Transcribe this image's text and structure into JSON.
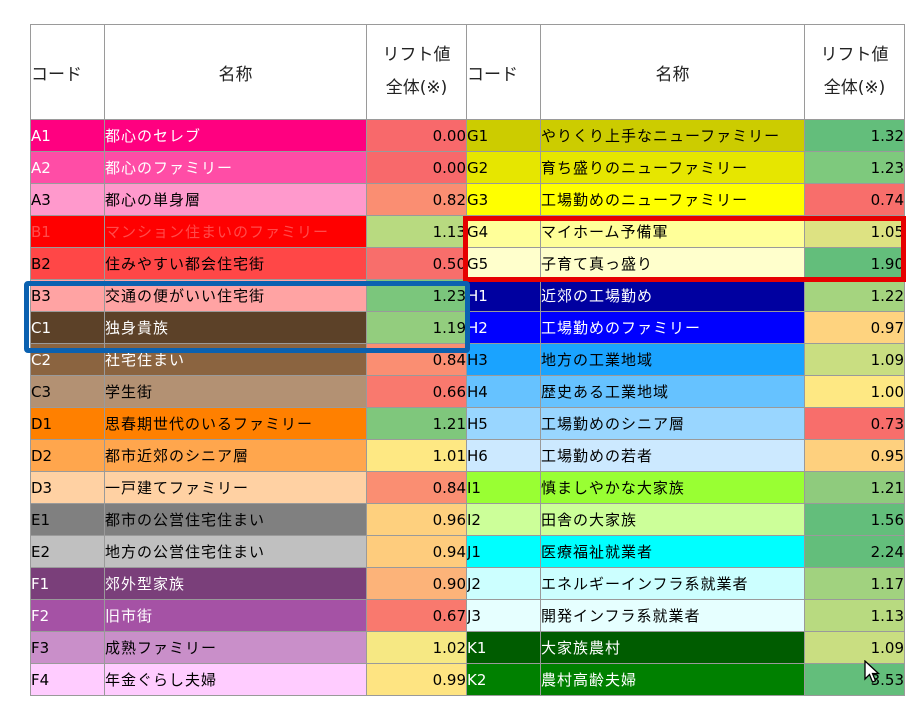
{
  "header": {
    "code": "コード",
    "name": "名称",
    "lift_line1": "リフト値",
    "lift_line2": "全体(※)"
  },
  "rows": [
    {
      "left": {
        "code": "A1",
        "name": "都心のセレブ",
        "value": "0.00",
        "bg": "#ff0080",
        "fg": "#ffffff",
        "vbg": "#f8696b"
      },
      "right": {
        "code": "G1",
        "name": "やりくり上手なニューファミリー",
        "value": "1.32",
        "bg": "#cccc00",
        "fg": "#000000",
        "vbg": "#63be7b"
      }
    },
    {
      "left": {
        "code": "A2",
        "name": "都心のファミリー",
        "value": "0.00",
        "bg": "#ff4da6",
        "fg": "#ffffff",
        "vbg": "#f8696b"
      },
      "right": {
        "code": "G2",
        "name": "育ち盛りのニューファミリー",
        "value": "1.23",
        "bg": "#e6e600",
        "fg": "#000000",
        "vbg": "#7ec97d"
      }
    },
    {
      "left": {
        "code": "A3",
        "name": "都心の単身層",
        "value": "0.82",
        "bg": "#ff99cc",
        "fg": "#000000",
        "vbg": "#fa8e72"
      },
      "right": {
        "code": "G3",
        "name": "工場勤めのニューファミリー",
        "value": "0.74",
        "bg": "#ffff00",
        "fg": "#000000",
        "vbg": "#f86e6b"
      }
    },
    {
      "left": {
        "code": "B1",
        "name": "マンション住まいのファミリー",
        "value": "1.13",
        "bg": "#ff0000",
        "fg": "#ff4b4b",
        "vbg": "#b8da80"
      },
      "right": {
        "code": "G4",
        "name": "マイホーム予備軍",
        "value": "1.05",
        "bg": "#ffff99",
        "fg": "#000000",
        "vbg": "#dde282"
      }
    },
    {
      "left": {
        "code": "B2",
        "name": "住みやすい都会住宅街",
        "value": "0.50",
        "bg": "#ff4747",
        "fg": "#000000",
        "vbg": "#f86e6b"
      },
      "right": {
        "code": "G5",
        "name": "子育て真っ盛り",
        "value": "1.90",
        "bg": "#ffffcc",
        "fg": "#000000",
        "vbg": "#63be7b"
      }
    },
    {
      "left": {
        "code": "B3",
        "name": "交通の便がいい住宅街",
        "value": "1.23",
        "bg": "#ffa3a3",
        "fg": "#000000",
        "vbg": "#7bc67c"
      },
      "right": {
        "code": "H1",
        "name": "近郊の工場勤め",
        "value": "1.22",
        "bg": "#0000a0",
        "fg": "#ffffff",
        "vbg": "#a5d47f"
      }
    },
    {
      "left": {
        "code": "C1",
        "name": "独身貴族",
        "value": "1.19",
        "bg": "#5c4128",
        "fg": "#ffffff",
        "vbg": "#93cd7e"
      },
      "right": {
        "code": "H2",
        "name": "工場勤めのファミリー",
        "value": "0.97",
        "bg": "#0000ff",
        "fg": "#ffffff",
        "vbg": "#fed37f"
      }
    },
    {
      "left": {
        "code": "C2",
        "name": "社宅住まい",
        "value": "0.84",
        "bg": "#8b6440",
        "fg": "#ffffff",
        "vbg": "#fa8e72"
      },
      "right": {
        "code": "H3",
        "name": "地方の工業地域",
        "value": "1.09",
        "bg": "#1aa3ff",
        "fg": "#000000",
        "vbg": "#c9de81"
      }
    },
    {
      "left": {
        "code": "C3",
        "name": "学生街",
        "value": "0.66",
        "bg": "#b39173",
        "fg": "#000000",
        "vbg": "#f9796e"
      },
      "right": {
        "code": "H4",
        "name": "歴史ある工業地域",
        "value": "1.00",
        "bg": "#66c2ff",
        "fg": "#000000",
        "vbg": "#fee883"
      }
    },
    {
      "left": {
        "code": "D1",
        "name": "思春期世代のいるファミリー",
        "value": "1.21",
        "bg": "#ff8000",
        "fg": "#000000",
        "vbg": "#7fc77c"
      },
      "right": {
        "code": "H5",
        "name": "工場勤めのシニア層",
        "value": "0.73",
        "bg": "#99d6ff",
        "fg": "#000000",
        "vbg": "#f86e6b"
      }
    },
    {
      "left": {
        "code": "D2",
        "name": "都市近郊のシニア層",
        "value": "1.01",
        "bg": "#ffa64d",
        "fg": "#000000",
        "vbg": "#fee883"
      },
      "right": {
        "code": "H6",
        "name": "工場勤めの若者",
        "value": "0.95",
        "bg": "#cce9ff",
        "fg": "#000000",
        "vbg": "#fed07e"
      }
    },
    {
      "left": {
        "code": "D3",
        "name": "一戸建てファミリー",
        "value": "0.84",
        "bg": "#ffd1a3",
        "fg": "#000000",
        "vbg": "#fa8e72"
      },
      "right": {
        "code": "I1",
        "name": "慎ましやかな大家族",
        "value": "1.21",
        "bg": "#99ff33",
        "fg": "#000000",
        "vbg": "#8fcb7d"
      }
    },
    {
      "left": {
        "code": "E1",
        "name": "都市の公営住宅住まい",
        "value": "0.96",
        "bg": "#808080",
        "fg": "#000000",
        "vbg": "#fed07e"
      },
      "right": {
        "code": "I2",
        "name": "田舎の大家族",
        "value": "1.56",
        "bg": "#ccff99",
        "fg": "#000000",
        "vbg": "#63be7b"
      }
    },
    {
      "left": {
        "code": "E2",
        "name": "地方の公営住宅住まい",
        "value": "0.94",
        "bg": "#c0c0c0",
        "fg": "#000000",
        "vbg": "#fecc7d"
      },
      "right": {
        "code": "J1",
        "name": "医療福祉就業者",
        "value": "2.24",
        "bg": "#00ffff",
        "fg": "#000000",
        "vbg": "#63be7b"
      }
    },
    {
      "left": {
        "code": "F1",
        "name": "郊外型家族",
        "value": "0.90",
        "bg": "#7a3f7a",
        "fg": "#ffffff",
        "vbg": "#fcb379"
      }
    },
    {
      "left": {
        "code": "F2",
        "name": "旧市街",
        "value": "0.67",
        "bg": "#a552a5",
        "fg": "#ffffff",
        "vbg": "#f9796e"
      },
      "right": {
        "code": "J3",
        "name": "開発インフラ系就業者",
        "value": "1.13",
        "bg": "#e6ffff",
        "fg": "#000000",
        "vbg": "#b8da80"
      }
    },
    {
      "left": {
        "code": "F3",
        "name": "成熟ファミリー",
        "value": "1.02",
        "bg": "#c98fc9",
        "fg": "#000000",
        "vbg": "#f6e883"
      },
      "right": {
        "code": "K1",
        "name": "大家族農村",
        "value": "1.09",
        "bg": "#005c00",
        "fg": "#ffffff",
        "vbg": "#c9de81"
      }
    },
    {
      "left": {
        "code": "F4",
        "name": "年金ぐらし夫婦",
        "value": "0.99",
        "bg": "#ffccff",
        "fg": "#000000",
        "vbg": "#fee482"
      },
      "right": {
        "code": "K2",
        "name": "農村高齢夫婦",
        "value": "3.53",
        "bg": "#008000",
        "fg": "#ffffff",
        "vbg": "#63be7b"
      }
    }
  ],
  "row15_right": {
    "code": "J2",
    "name": "エネルギーインフラ系就業者",
    "value": "1.17",
    "bg": "#ccffff",
    "fg": "#000000",
    "vbg": "#a1d27f"
  }
}
